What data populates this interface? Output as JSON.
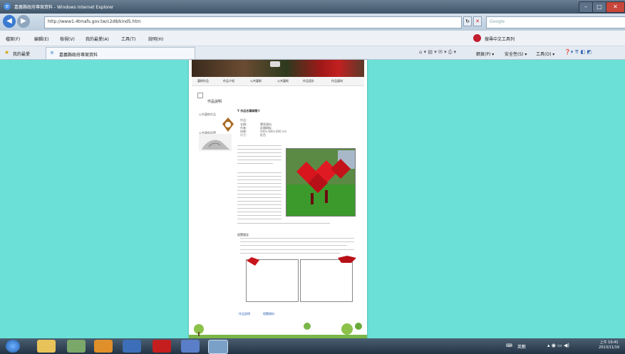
{
  "window": {
    "title": "嘉義縣政府專案資料 - Windows Internet Explorer",
    "minimize": "–",
    "maximize": "□",
    "close": "✕"
  },
  "address": {
    "url": "http://www1.4tmafs.gov.tw/c2d8/kind5.htm",
    "search_placeholder": "Google"
  },
  "menu": {
    "items": [
      "檔案(F)",
      "編輯(E)",
      "檢視(V)",
      "我的最愛(A)",
      "工具(T)",
      "說明(H)"
    ],
    "toolbar_label": "搜尋中文工具列"
  },
  "favorites": {
    "label": "我的最愛",
    "tab": "嘉義縣政府專案資料",
    "tools": [
      "網頁(P) ▾",
      "安全性(S) ▾",
      "工具(O) ▾"
    ]
  },
  "page": {
    "nav_tabs": [
      "藝術作品",
      "作品介紹",
      "公共藝術",
      "公共藝術",
      "作品設計",
      "作品媒材"
    ],
    "side_heading": "作品說明",
    "side_label1": "公共藝術作品",
    "side_label2": "公共藝術設置",
    "article_title": "Y 作品名稱與簡介",
    "meta": [
      "作品：",
      "名稱：",
      "作者：",
      "材質：",
      "尺寸："
    ],
    "meta_values": [
      "專案資料",
      "彩繪鋼板",
      "500×300×400 cm",
      "紅色"
    ],
    "section2": "設置理念",
    "links": [
      "作品說明",
      "相關資料"
    ]
  },
  "taskbar": {
    "lang": "英數",
    "time": "上午 10:41",
    "date": "2013/11/19"
  }
}
